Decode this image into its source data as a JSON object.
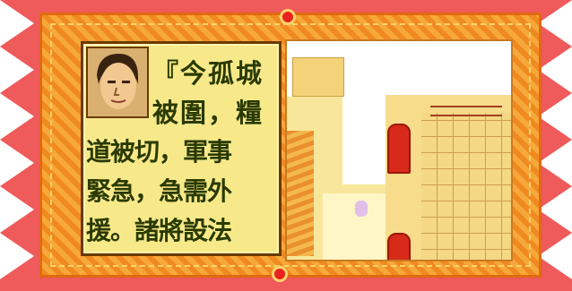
{
  "dialog": {
    "lines": [
      "『今孤城",
      "被圍，糧",
      "道被切，軍事",
      "緊急，急需外",
      "援。諸將設法"
    ]
  },
  "colors": {
    "banner_edge": "#ef5a5a",
    "frame_orange": "#f08a20",
    "dialog_bg": "#f7e98a",
    "pillar_red": "#d82a1a"
  },
  "icons": {
    "medallion": "red-medallion-icon",
    "portrait": "general-portrait-icon"
  }
}
